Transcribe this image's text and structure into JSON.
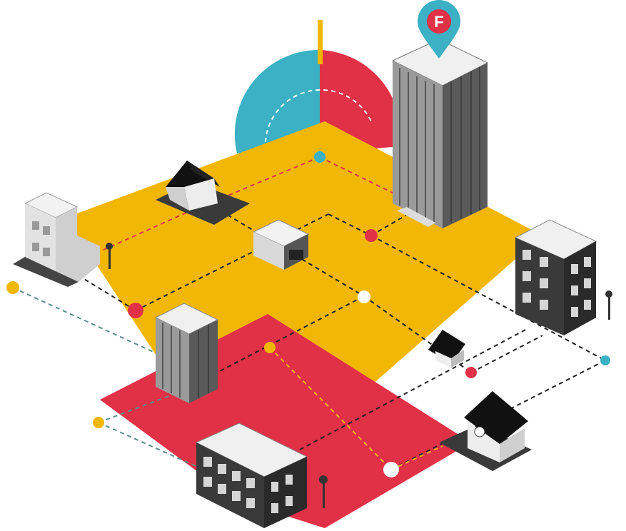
{
  "pin": {
    "letter": "F",
    "icon": "map-pin-icon"
  },
  "colors": {
    "yellow": "#F2B705",
    "red": "#E03146",
    "teal": "#3CB0C4",
    "white": "#FFFFFF",
    "dark": "#1F1F1F",
    "building_light": "#EDEDED",
    "building_mid": "#BDBDBD",
    "building_dark": "#3A3A3A"
  },
  "elements": {
    "planes": [
      "yellow-plane",
      "red-plane",
      "half-circle-blue",
      "half-circle-red"
    ],
    "buildings": [
      "skyscraper-tall",
      "office-mid",
      "apartment-dark",
      "shop-small",
      "house-top",
      "house-right",
      "house-small",
      "apartment-left",
      "office-low"
    ],
    "nodes": [
      "teal-node",
      "red-node",
      "white-node",
      "yellow-node"
    ]
  }
}
